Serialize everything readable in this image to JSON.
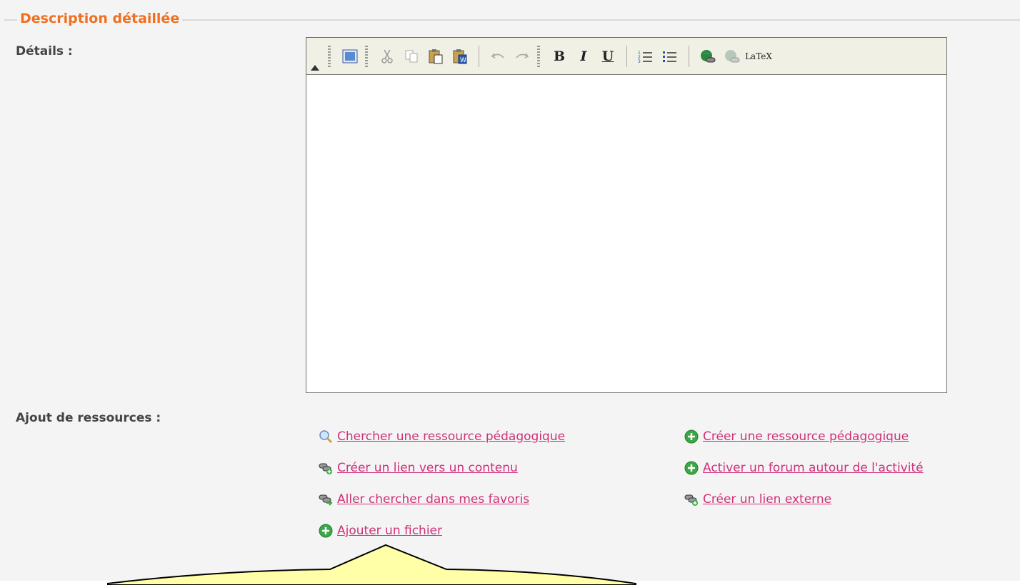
{
  "section": {
    "legend": "Description détaillée"
  },
  "details": {
    "label": "Détails :"
  },
  "editor": {
    "toolbar": [
      {
        "name": "source-icon"
      },
      {
        "name": "cut-icon"
      },
      {
        "name": "copy-icon"
      },
      {
        "name": "paste-icon"
      },
      {
        "name": "paste-word-icon"
      },
      {
        "name": "undo-icon"
      },
      {
        "name": "redo-icon"
      },
      {
        "name": "bold-icon",
        "glyph": "B"
      },
      {
        "name": "italic-icon",
        "glyph": "I"
      },
      {
        "name": "underline-icon",
        "glyph": "U"
      },
      {
        "name": "ordered-list-icon"
      },
      {
        "name": "unordered-list-icon"
      },
      {
        "name": "link-icon"
      },
      {
        "name": "unlink-icon"
      },
      {
        "name": "latex-icon",
        "glyph": "LaTeX"
      }
    ],
    "content": ""
  },
  "resources": {
    "label": "Ajout de ressources :",
    "links": {
      "search_resource": "Chercher une ressource pédagogique",
      "create_resource": "Créer une ressource pédagogique",
      "create_link_content": "Créer un lien vers un contenu",
      "activate_forum": "Activer un forum autour de l'activité",
      "favorites": "Aller chercher dans mes favoris",
      "create_external_link": "Créer un lien externe",
      "add_file": "Ajouter un fichier"
    }
  },
  "colors": {
    "legend": "#f07020",
    "link": "#d0307a",
    "callout_fill": "#ffffa8",
    "add_icon": "#3aa845"
  }
}
